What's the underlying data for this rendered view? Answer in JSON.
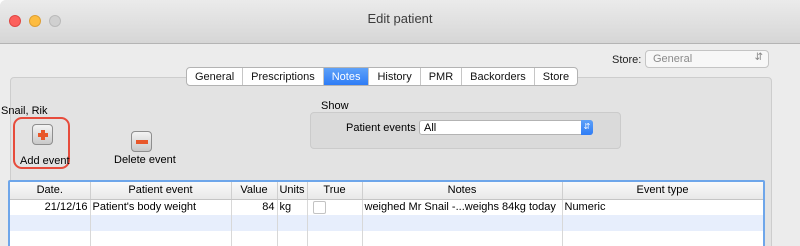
{
  "window": {
    "title": "Edit patient"
  },
  "store": {
    "label": "Store:",
    "value": "General"
  },
  "tabs": [
    "General",
    "Prescriptions",
    "Notes",
    "History",
    "PMR",
    "Backorders",
    "Store"
  ],
  "active_tab": "Notes",
  "patient": {
    "name": "Snail, Rik"
  },
  "buttons": {
    "add_event": "Add event",
    "delete_event": "Delete event"
  },
  "show": {
    "title": "Show",
    "filter_label": "Patient events",
    "filter_value": "All"
  },
  "table": {
    "columns": [
      "Date.",
      "Patient event",
      "Value",
      "Units",
      "True",
      "Notes",
      "Event type"
    ],
    "rows": [
      {
        "date": "21/12/16",
        "event": "Patient's body weight",
        "value": "84",
        "units": "kg",
        "true": false,
        "notes": "weighed Mr Snail -...weighs 84kg today",
        "type": "Numeric"
      }
    ]
  },
  "colors": {
    "accent": "#2e7cf6",
    "highlight_border": "#e74c3c",
    "table_focus": "#6ea6ea"
  }
}
